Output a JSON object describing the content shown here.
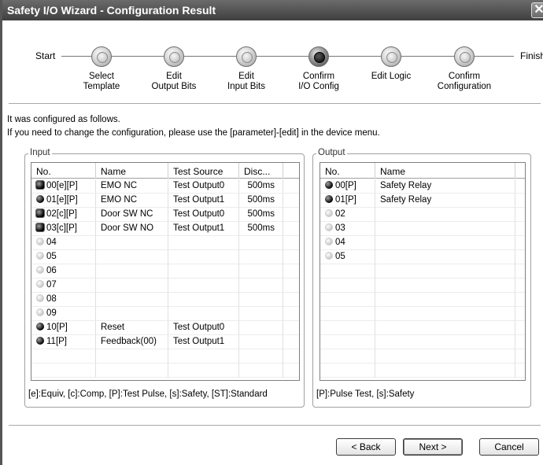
{
  "window": {
    "title": "Safety I/O Wizard - Configuration Result",
    "close_glyph": "✕"
  },
  "progress": {
    "start_label": "Start",
    "finish_label": "Finish",
    "steps": [
      {
        "label1": "Select",
        "label2": "Template",
        "active": false
      },
      {
        "label1": "Edit",
        "label2": "Output Bits",
        "active": false
      },
      {
        "label1": "Edit",
        "label2": "Input Bits",
        "active": false
      },
      {
        "label1": "Confirm",
        "label2": "I/O Config",
        "active": true
      },
      {
        "label1": "Edit Logic",
        "label2": "",
        "active": false
      },
      {
        "label1": "Confirm",
        "label2": "Configuration",
        "active": false
      }
    ]
  },
  "info": {
    "line1": "It was configured as follows.",
    "line2": "If you need to change the configuration, please use the [parameter]-[edit] in the device menu."
  },
  "input_group": {
    "title": "Input",
    "columns": [
      "No.",
      "Name",
      "Test Source",
      "Disc..."
    ],
    "rows": [
      {
        "icon": "black-square-dot-icon",
        "no": "00[e][P]",
        "name": "EMO NC",
        "test_source": "Test Output0",
        "disc": "500ms"
      },
      {
        "icon": "black-dot-icon",
        "no": "01[e][P]",
        "name": "EMO NC",
        "test_source": "Test Output1",
        "disc": "500ms"
      },
      {
        "icon": "black-square-dot-icon",
        "no": "02[c][P]",
        "name": "Door SW NC",
        "test_source": "Test Output0",
        "disc": "500ms"
      },
      {
        "icon": "black-square-dot-icon",
        "no": "03[c][P]",
        "name": "Door SW NO",
        "test_source": "Test Output1",
        "disc": "500ms"
      },
      {
        "icon": "gray-dot-icon",
        "no": "04",
        "name": "",
        "test_source": "",
        "disc": ""
      },
      {
        "icon": "gray-dot-icon",
        "no": "05",
        "name": "",
        "test_source": "",
        "disc": ""
      },
      {
        "icon": "gray-dot-icon",
        "no": "06",
        "name": "",
        "test_source": "",
        "disc": ""
      },
      {
        "icon": "gray-dot-icon",
        "no": "07",
        "name": "",
        "test_source": "",
        "disc": ""
      },
      {
        "icon": "gray-dot-icon",
        "no": "08",
        "name": "",
        "test_source": "",
        "disc": ""
      },
      {
        "icon": "gray-dot-icon",
        "no": "09",
        "name": "",
        "test_source": "",
        "disc": ""
      },
      {
        "icon": "black-dot-icon",
        "no": "10[P]",
        "name": "Reset",
        "test_source": "Test Output0",
        "disc": ""
      },
      {
        "icon": "black-dot-icon",
        "no": "11[P]",
        "name": "Feedback(00)",
        "test_source": "Test Output1",
        "disc": ""
      }
    ],
    "legend": "[e]:Equiv, [c]:Comp, [P]:Test Pulse, [s]:Safety, [ST]:Standard"
  },
  "output_group": {
    "title": "Output",
    "columns": [
      "No.",
      "Name"
    ],
    "rows": [
      {
        "icon": "black-dot-icon",
        "no": "00[P]",
        "name": "Safety Relay"
      },
      {
        "icon": "black-dot-icon",
        "no": "01[P]",
        "name": "Safety Relay"
      },
      {
        "icon": "gray-dot-icon",
        "no": "02",
        "name": ""
      },
      {
        "icon": "gray-dot-icon",
        "no": "03",
        "name": ""
      },
      {
        "icon": "gray-dot-icon",
        "no": "04",
        "name": ""
      },
      {
        "icon": "gray-dot-icon",
        "no": "05",
        "name": ""
      }
    ],
    "legend": "[P]:Pulse Test, [s]:Safety"
  },
  "buttons": {
    "back": "< Back",
    "next": "Next >",
    "cancel": "Cancel"
  }
}
